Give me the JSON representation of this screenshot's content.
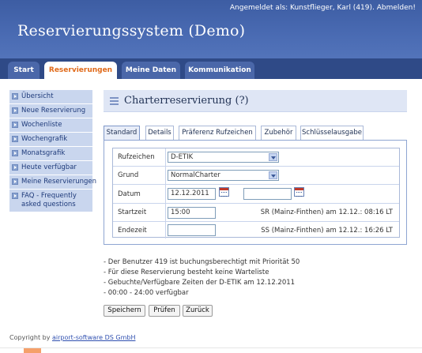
{
  "header": {
    "login_text": "Angemeldet als: Kunstflieger, Karl (419).",
    "logout_label": "Abmelden!",
    "title": "Reservierungssystem (Demo)"
  },
  "nav": {
    "tabs": [
      {
        "label": "Start"
      },
      {
        "label": "Reservierungen"
      },
      {
        "label": "Meine Daten"
      },
      {
        "label": "Kommunikation"
      }
    ],
    "active_tab": "Reservierungen"
  },
  "sidebar": {
    "items": [
      {
        "label": "Übersicht"
      },
      {
        "label": "Neue Reservierung"
      },
      {
        "label": "Wochenliste"
      },
      {
        "label": "Wochengrafik"
      },
      {
        "label": "Monatsgrafik"
      },
      {
        "label": "Heute verfügbar"
      },
      {
        "label": "Meine Reservierungen"
      },
      {
        "label": "FAQ - Frequently asked questions"
      }
    ]
  },
  "page": {
    "title": "Charterreservierung (?)"
  },
  "subtabs": [
    {
      "label": "Standard"
    },
    {
      "label": "Details"
    },
    {
      "label": "Präferenz Rufzeichen"
    },
    {
      "label": "Zubehör"
    },
    {
      "label": "Schlüsselausgabe"
    }
  ],
  "form": {
    "rufzeichen_label": "Rufzeichen",
    "rufzeichen_value": "D-ETIK",
    "grund_label": "Grund",
    "grund_value": "NormalCharter",
    "datum_label": "Datum",
    "datum_value": "12.12.2011",
    "datum_end_value": "",
    "startzeit_label": "Startzeit",
    "startzeit_value": "15:00",
    "sunrise_text": "SR (Mainz-Finthen) am 12.12.: 08:16 LT",
    "endzeit_label": "Endezeit",
    "endzeit_value": "",
    "sunset_text": "SS (Mainz-Finthen) am 12.12.: 16:26 LT"
  },
  "notes": [
    "- Der Benutzer 419 ist buchungsberechtigt mit Priorität 50",
    "- Für diese Reservierung besteht keine Warteliste",
    "- Gebuchte/Verfügbare Zeiten der D-ETIK am 12.12.2011",
    "- 00:00 - 24:00 verfügbar"
  ],
  "buttons": {
    "save": "Speichern",
    "check": "Prüfen",
    "back": "Zurück"
  },
  "footer": {
    "prefix": "Copyright by",
    "link": "airport-software DS GmbH"
  },
  "icons": [
    "menu-icon",
    "calendar-icon",
    "bullet-arrow-icon",
    "chevron-down-icon"
  ]
}
